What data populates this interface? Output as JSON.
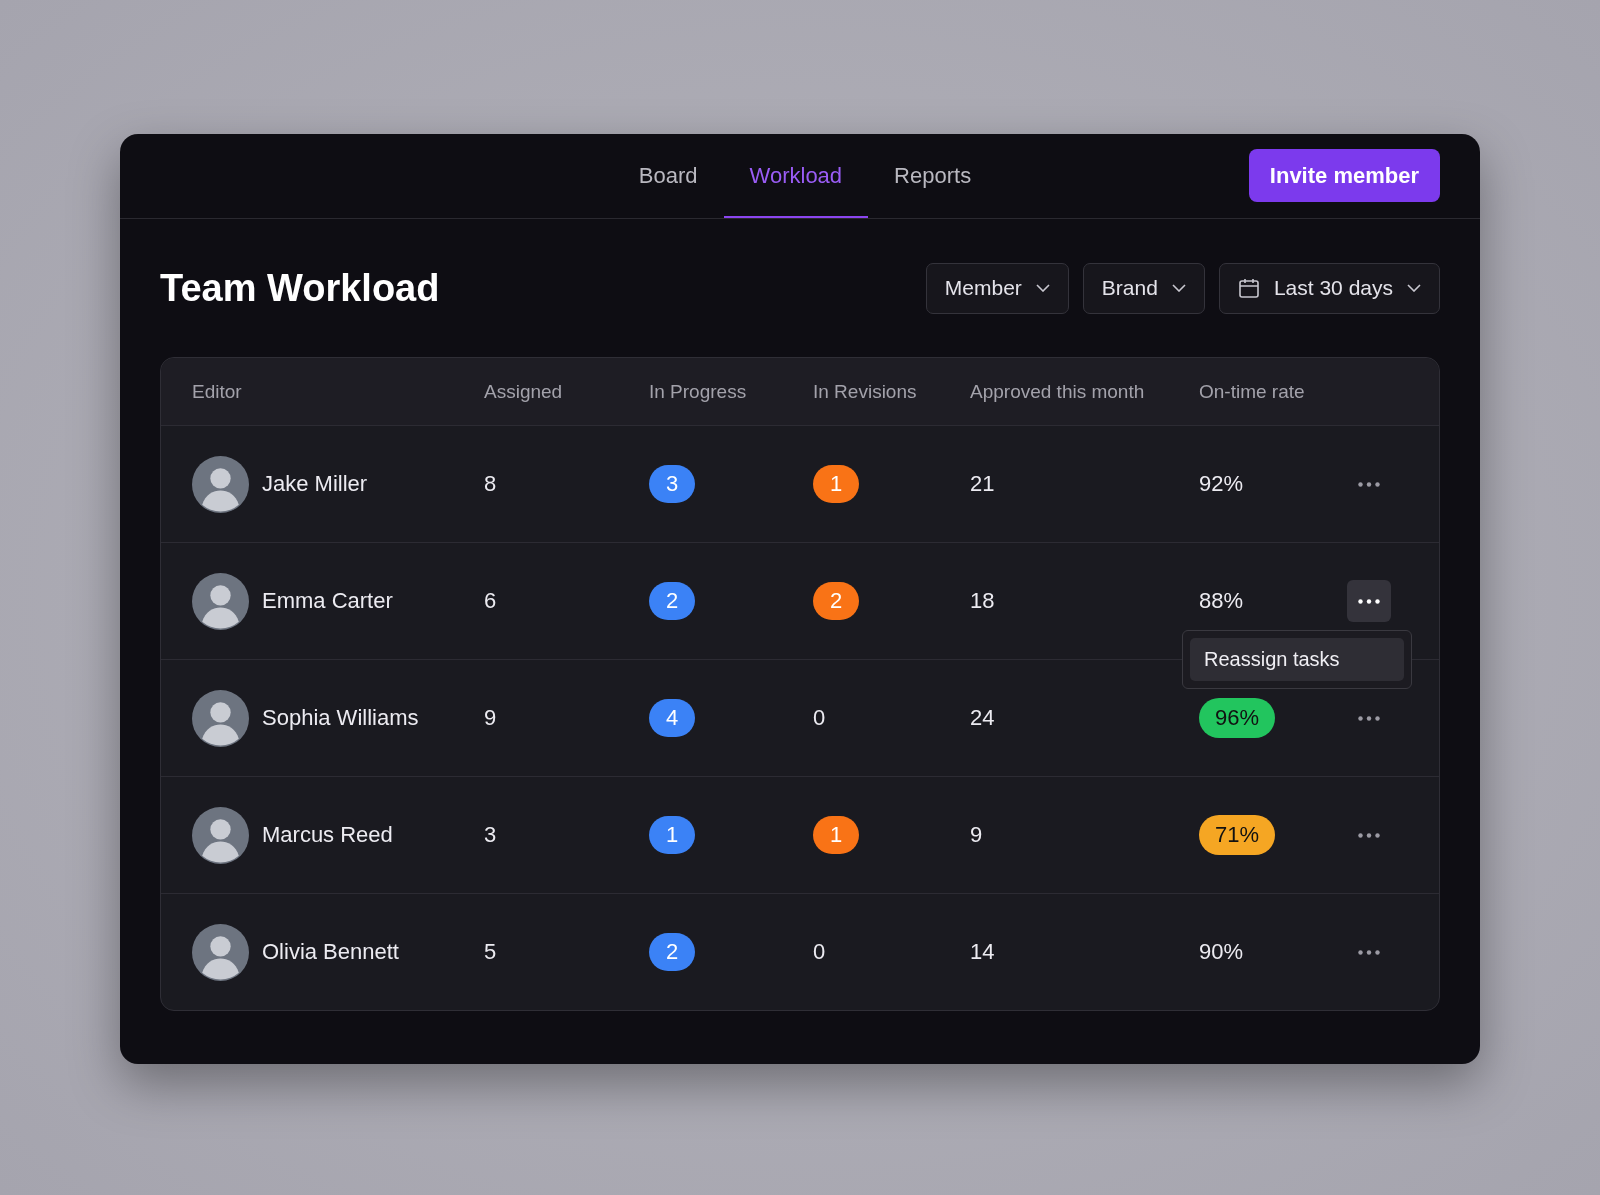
{
  "nav": {
    "tabs": [
      {
        "label": "Board",
        "selected": false
      },
      {
        "label": "Workload",
        "selected": true
      },
      {
        "label": "Reports",
        "selected": false
      }
    ],
    "invite_button": "Invite member"
  },
  "title": "Team Workload",
  "filters": [
    {
      "label": "Member",
      "kind": "dropdown"
    },
    {
      "label": "Brand",
      "kind": "dropdown"
    },
    {
      "label": "Last 30 days",
      "kind": "date"
    }
  ],
  "table": {
    "columns": [
      "Editor",
      "Assigned",
      "In Progress",
      "In Revisions",
      "Approved this month",
      "On-time rate"
    ],
    "rows": [
      {
        "editor": "Jake Miller",
        "assigned": "8",
        "in_progress": "3",
        "in_revisions": "1",
        "revisions_badge": true,
        "approved": "21",
        "on_time": {
          "text": "92%",
          "kind": "plain"
        },
        "menu_open": false
      },
      {
        "editor": "Emma Carter",
        "assigned": "6",
        "in_progress": "2",
        "in_revisions": "2",
        "revisions_badge": true,
        "approved": "18",
        "on_time": {
          "text": "88%",
          "kind": "plain"
        },
        "menu_open": true,
        "menu_items": [
          "Reassign tasks"
        ]
      },
      {
        "editor": "Sophia Williams",
        "assigned": "9",
        "in_progress": "4",
        "in_revisions": "0",
        "revisions_badge": false,
        "approved": "24",
        "on_time": {
          "text": "96%",
          "kind": "good"
        },
        "menu_open": false
      },
      {
        "editor": "Marcus Reed",
        "assigned": "3",
        "in_progress": "1",
        "in_revisions": "1",
        "revisions_badge": true,
        "approved": "9",
        "on_time": {
          "text": "71%",
          "kind": "warning"
        },
        "menu_open": false
      },
      {
        "editor": "Olivia Bennett",
        "assigned": "5",
        "in_progress": "2",
        "in_revisions": "0",
        "revisions_badge": false,
        "approved": "14",
        "on_time": {
          "text": "90%",
          "kind": "plain"
        },
        "menu_open": false
      }
    ]
  }
}
